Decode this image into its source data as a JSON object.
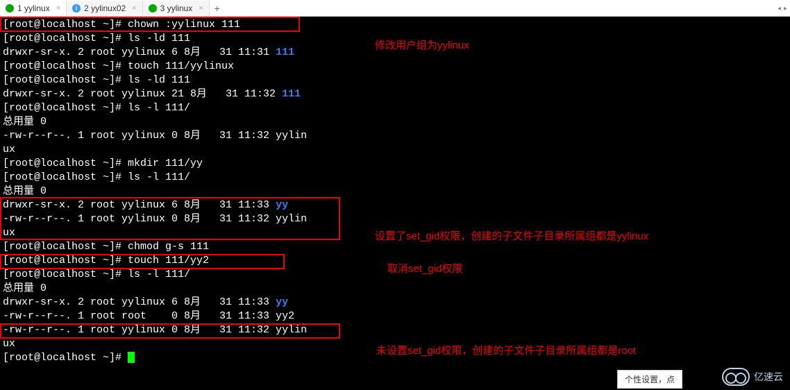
{
  "tabs": [
    {
      "label": "1 yylinux",
      "icon": "green",
      "active": true
    },
    {
      "label": "2 yylinux02",
      "icon": "blue-i",
      "active": false
    },
    {
      "label": "3 yylinux",
      "icon": "green",
      "active": false
    }
  ],
  "term": {
    "l01_prompt": "[root@localhost ~]# ",
    "l01_cmd": "chown :yylinux 111",
    "l02_prompt": "[root@localhost ~]# ",
    "l02_cmd": "ls -ld 111",
    "l03a": "drwxr-sr-x. 2 root yylinux 6 8月   31 11:31 ",
    "l03b": "111",
    "l04_prompt": "[root@localhost ~]# ",
    "l04_cmd": "touch 111/yylinux",
    "l05_prompt": "[root@localhost ~]# ",
    "l05_cmd": "ls -ld 111",
    "l06a": "drwxr-sr-x. 2 root yylinux 21 8月   31 11:32 ",
    "l06b": "111",
    "l07_prompt": "[root@localhost ~]# ",
    "l07_cmd": "ls -l 111/",
    "l08": "总用量 0",
    "l09": "-rw-r--r--. 1 root yylinux 0 8月   31 11:32 yylin",
    "l10": "ux",
    "l11_prompt": "[root@localhost ~]# ",
    "l11_cmd": "mkdir 111/yy",
    "l12_prompt": "[root@localhost ~]# ",
    "l12_cmd": "ls -l 111/",
    "l13": "总用量 0",
    "l14a": "drwxr-sr-x. 2 root yylinux 6 8月   31 11:33 ",
    "l14b": "yy",
    "l15": "-rw-r--r--. 1 root yylinux 0 8月   31 11:32 yylin",
    "l16": "ux",
    "l17_prompt": "[root@localhost ~]# ",
    "l17_cmd": "chmod g-s 111",
    "l18_prompt": "[root@localhost ~]# ",
    "l18_cmd": "touch 111/yy2",
    "l19_prompt": "[root@localhost ~]# ",
    "l19_cmd": "ls -l 111/",
    "l20": "总用量 0",
    "l21a": "drwxr-sr-x. 2 root yylinux 6 8月   31 11:33 ",
    "l21b": "yy",
    "l22": "-rw-r--r--. 1 root root    0 8月   31 11:33 yy2",
    "l23": "-rw-r--r--. 1 root yylinux 0 8月   31 11:32 yylin",
    "l24": "ux",
    "l25_prompt": "[root@localhost ~]# "
  },
  "annotations": {
    "a1": "修改用户组为yylinux",
    "a2": "设置了set_gid权限，创建的子文件子目录所属组都是yylinux",
    "a3": "取消set_gid权限",
    "a4": "未设置set_gid权限，创建的子文件子目录所属组都是root"
  },
  "watermark": "亿速云",
  "settings": "个性设置，点"
}
